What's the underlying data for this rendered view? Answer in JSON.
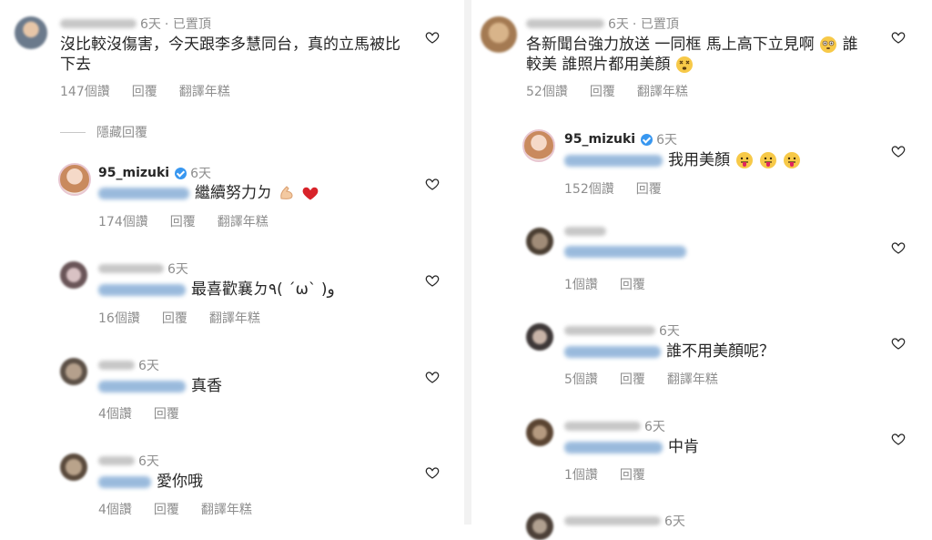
{
  "labels": {
    "likes_suffix": "個讚",
    "reply": "回覆",
    "translate": "翻譯年糕",
    "hide_replies": "隱藏回覆"
  },
  "left": {
    "top_comment": {
      "time": "6天",
      "pinned": "· 已置頂",
      "text": "沒比較沒傷害，今天跟李多慧同台，真的立馬被比下去",
      "likes": "147個讚"
    },
    "replies": [
      {
        "user": "95_mizuki",
        "time": "6天",
        "text": "繼續努力ㄉ",
        "likes": "174個讚"
      },
      {
        "time": "6天",
        "text": "最喜歡襄ㄉ٩( ´ω` )و",
        "likes": "16個讚"
      },
      {
        "time": "6天",
        "text": "真香",
        "likes": "4個讚"
      },
      {
        "time": "6天",
        "text": "愛你哦",
        "likes": "4個讚"
      }
    ]
  },
  "right": {
    "top_comment": {
      "time": "6天",
      "pinned": "· 已置頂",
      "text": "各新聞台強力放送 一同框 馬上高下立見啊",
      "text2": "誰較美 誰照片都用美顏",
      "likes": "52個讚"
    },
    "replies": [
      {
        "user": "95_mizuki",
        "time": "6天",
        "text": "我用美顏",
        "likes": "152個讚"
      },
      {
        "text": "",
        "likes": "1個讚"
      },
      {
        "time": "6天",
        "text": "誰不用美顏呢？",
        "likes": "5個讚"
      },
      {
        "time": "6天",
        "text": "中肯",
        "likes": "1個讚"
      },
      {
        "time": "6天"
      }
    ]
  },
  "colors": {
    "verified": "#3897f0",
    "meta": "#8e8e8e",
    "text": "#262626",
    "heart_red": "#e0245e"
  },
  "icons": {
    "like": "heart-outline-icon",
    "verified": "verified-badge-icon"
  }
}
